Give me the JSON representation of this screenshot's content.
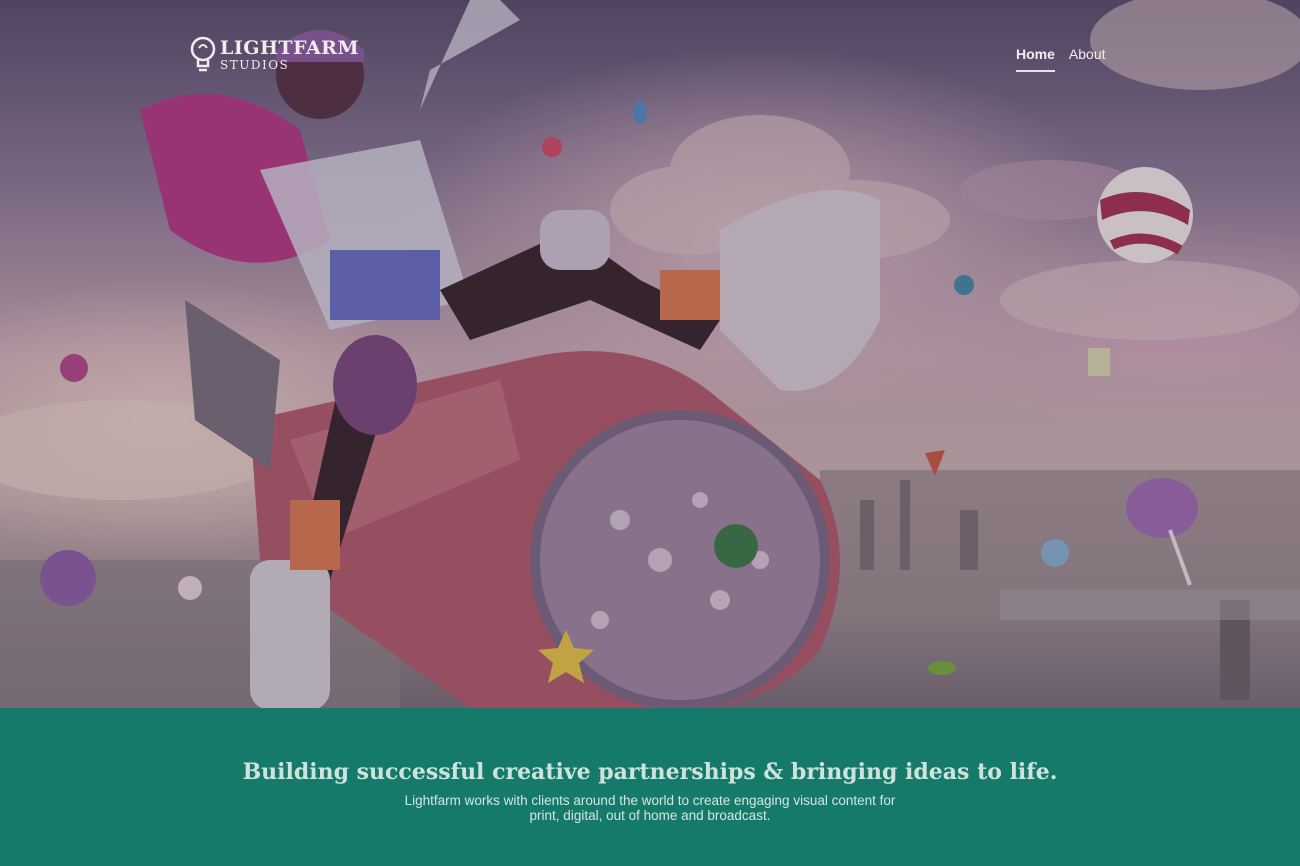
{
  "brand": {
    "name": "LIGHTFARM",
    "subtitle": "STUDIOS"
  },
  "nav": {
    "items": [
      {
        "label": "Home",
        "active": true
      },
      {
        "label": "About",
        "active": false
      }
    ]
  },
  "hero": {
    "image": "woman-riding-candy-rocket"
  },
  "band": {
    "headline": "Building successful creative partnerships & bringing ideas to life.",
    "body": "Lightfarm works with clients around the world to create engaging visual content for print, digital, out of home and broadcast."
  },
  "colors": {
    "band_bg": "#167a6b",
    "nav_text": "#f3eef2"
  }
}
